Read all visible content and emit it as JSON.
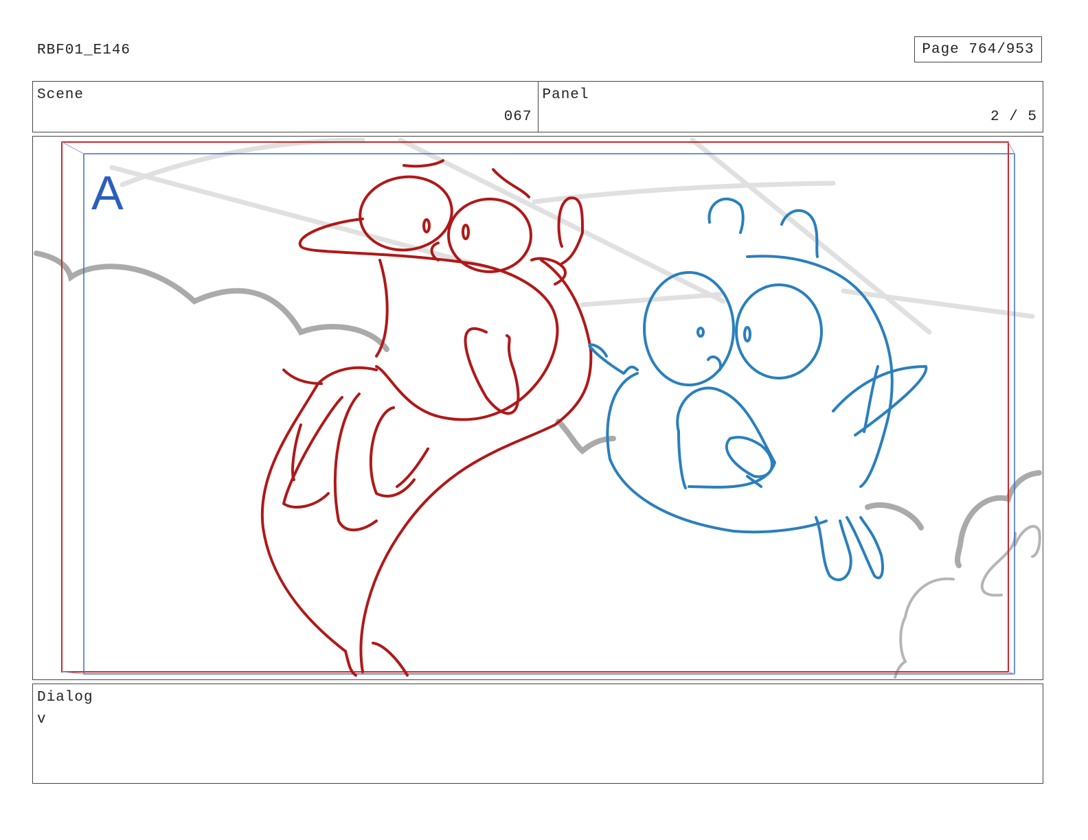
{
  "header": {
    "episode": "RBF01_E146",
    "page": "Page 764/953"
  },
  "info": {
    "scene_label": "Scene",
    "scene_value": "067",
    "panel_label": "Panel",
    "panel_value": "2 / 5"
  },
  "panel": {
    "marker": "A",
    "colors": {
      "red_char": "#b01818",
      "blue_char": "#2a7fbc",
      "clouds": "#aaaaaa",
      "speedlines": "#dddddd",
      "safe_frame_red": "#c42a2a",
      "safe_frame_blue": "#3a6cc6",
      "marker": "#2a5fbf"
    }
  },
  "dialog": {
    "label": "Dialog",
    "text": "v"
  }
}
